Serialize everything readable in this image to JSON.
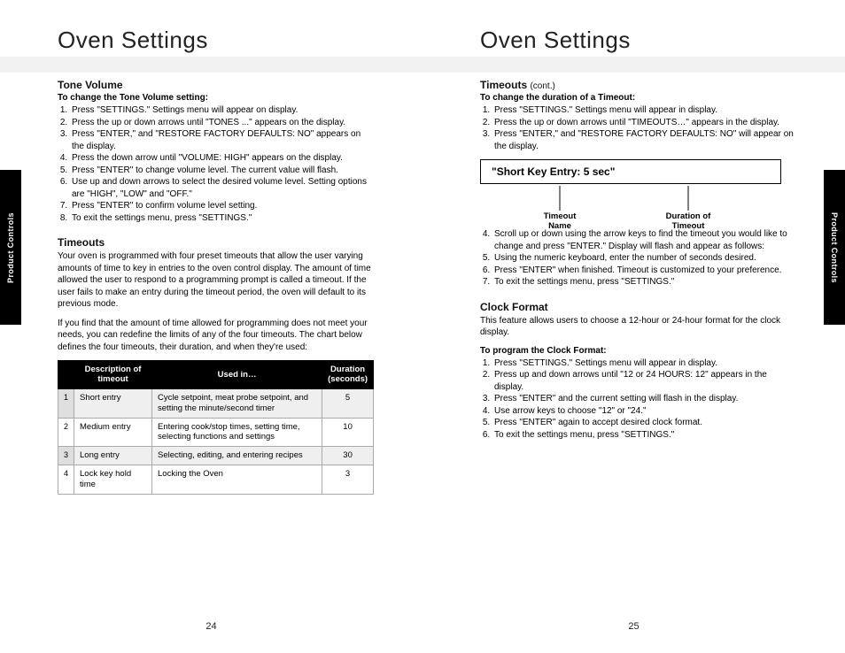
{
  "leftTab": "Product Controls",
  "rightTab": "Product Controls",
  "page24": {
    "title": "Oven Settings",
    "tone": {
      "heading": "Tone Volume",
      "sub": "To change the Tone Volume setting:",
      "steps": [
        "Press \"SETTINGS.\" Settings menu will appear on display.",
        "Press the up or down arrows until \"TONES ...\" appears on the display.",
        "Press \"ENTER,\" and \"RESTORE FACTORY DEFAULTS: NO\" appears on the display.",
        "Press the down arrow until \"VOLUME: HIGH\" appears on the display.",
        "Press \"ENTER\" to change volume level. The current value will flash.",
        "Use up and down arrows to select the desired volume level. Setting options are \"HIGH\", \"LOW\" and \"OFF.\"",
        "Press \"ENTER\" to confirm volume level setting.",
        "To exit the settings menu, press \"SETTINGS.\""
      ]
    },
    "timeouts": {
      "heading": "Timeouts",
      "p1": "Your oven is programmed with four preset timeouts that allow the user varying amounts of time to key in entries to the oven control display. The amount of time allowed the user to respond to a programming prompt is called a timeout. If the user fails to make an entry during the timeout period, the oven will default to its previous mode.",
      "p2": "If you find that the amount of time allowed for programming does not meet your needs, you can redefine the limits of any of the four timeouts. The chart below defines the four timeouts, their duration, and when they're used:",
      "table": {
        "h1": "Description of timeout",
        "h2": "Used in…",
        "h3": "Duration (seconds)",
        "rows": [
          {
            "n": "1",
            "desc": "Short entry",
            "used": "Cycle setpoint, meat probe setpoint, and setting the minute/second timer",
            "dur": "5"
          },
          {
            "n": "2",
            "desc": "Medium entry",
            "used": "Entering cook/stop times, setting time, selecting functions and settings",
            "dur": "10"
          },
          {
            "n": "3",
            "desc": "Long entry",
            "used": "Selecting, editing, and entering recipes",
            "dur": "30"
          },
          {
            "n": "4",
            "desc": "Lock key hold time",
            "used": "Locking the Oven",
            "dur": "3"
          }
        ]
      }
    },
    "num": "24"
  },
  "page25": {
    "title": "Oven Settings",
    "timeoutsCont": {
      "heading": "Timeouts",
      "cont": "(cont.)",
      "sub": "To change the duration of a Timeout:",
      "steps1": [
        "Press \"SETTINGS.\" Settings menu will appear in display.",
        "Press the up or down arrows until \"TIMEOUTS…\" appears in the display.",
        "Press \"ENTER,\" and \"RESTORE FACTORY DEFAULTS: NO\" will appear on the display."
      ],
      "display": "\"Short Key Entry: 5 sec\"",
      "label1a": "Timeout",
      "label1b": "Name",
      "label2a": "Duration of",
      "label2b": "Timeout",
      "steps2": [
        "Scroll up or down using the arrow keys to find the timeout you would like to change and press \"ENTER.\" Display will flash and appear as follows:",
        "Using the numeric keyboard, enter the number of seconds desired.",
        "Press \"ENTER\" when finished. Timeout is customized to your preference.",
        "To exit the settings menu, press \"SETTINGS.\""
      ]
    },
    "clock": {
      "heading": "Clock Format",
      "p1": "This feature allows users to choose a 12-hour or 24-hour format for the clock display.",
      "sub": "To program the Clock Format:",
      "steps": [
        "Press \"SETTINGS.\" Settings menu will appear in display.",
        "Press up and down arrows until \"12 or 24 HOURS: 12\" appears in the display.",
        "Press \"ENTER\" and the current setting will flash in the display.",
        "Use arrow keys to choose \"12\" or \"24.\"",
        "Press \"ENTER\" again to accept desired clock format.",
        "To exit the settings menu, press \"SETTINGS.\""
      ]
    },
    "num": "25"
  }
}
